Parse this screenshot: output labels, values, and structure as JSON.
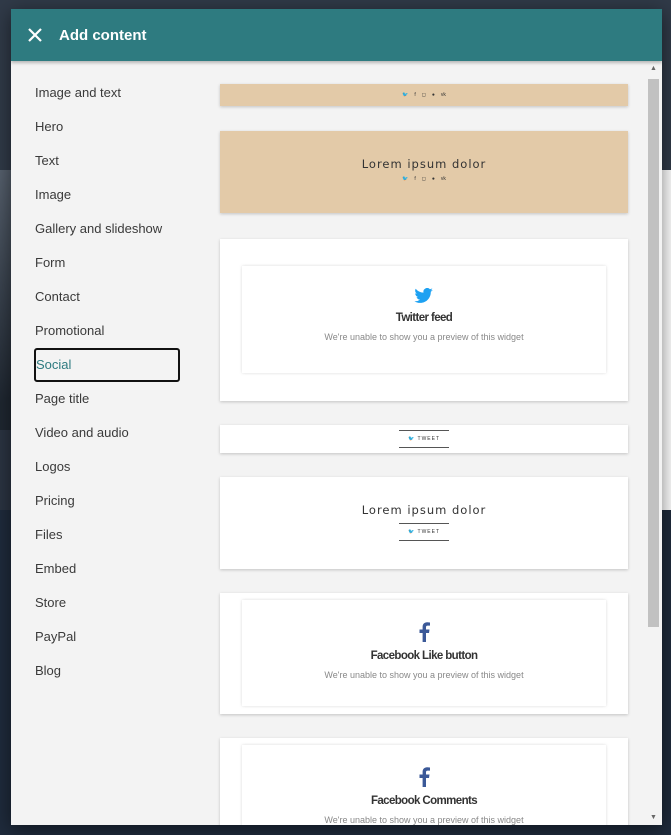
{
  "dialog": {
    "title": "Add content"
  },
  "sidebar": {
    "items": [
      {
        "label": "Image and text"
      },
      {
        "label": "Hero"
      },
      {
        "label": "Text"
      },
      {
        "label": "Image"
      },
      {
        "label": "Gallery and slideshow"
      },
      {
        "label": "Form"
      },
      {
        "label": "Contact"
      },
      {
        "label": "Promotional"
      },
      {
        "label": "Social",
        "active": true
      },
      {
        "label": "Page title"
      },
      {
        "label": "Video and audio"
      },
      {
        "label": "Logos"
      },
      {
        "label": "Pricing"
      },
      {
        "label": "Files"
      },
      {
        "label": "Embed"
      },
      {
        "label": "Store"
      },
      {
        "label": "PayPal"
      },
      {
        "label": "Blog"
      }
    ]
  },
  "previews": {
    "hero_heading": "Lorem ipsum dolor",
    "tweet_section_heading": "Lorem ipsum dolor",
    "tweet_label": "TWEET",
    "twitter_feed": {
      "name": "Twitter feed",
      "message": "We're unable to show you a preview of this widget"
    },
    "facebook_like": {
      "name": "Facebook Like button",
      "message": "We're unable to show you a preview of this widget"
    },
    "facebook_comments": {
      "name": "Facebook Comments",
      "message": "We're unable to show you a preview of this widget"
    }
  },
  "colors": {
    "header": "#2e7b80",
    "tan": "#e3caa8",
    "twitter": "#1da1f2",
    "facebook": "#3b5998"
  }
}
